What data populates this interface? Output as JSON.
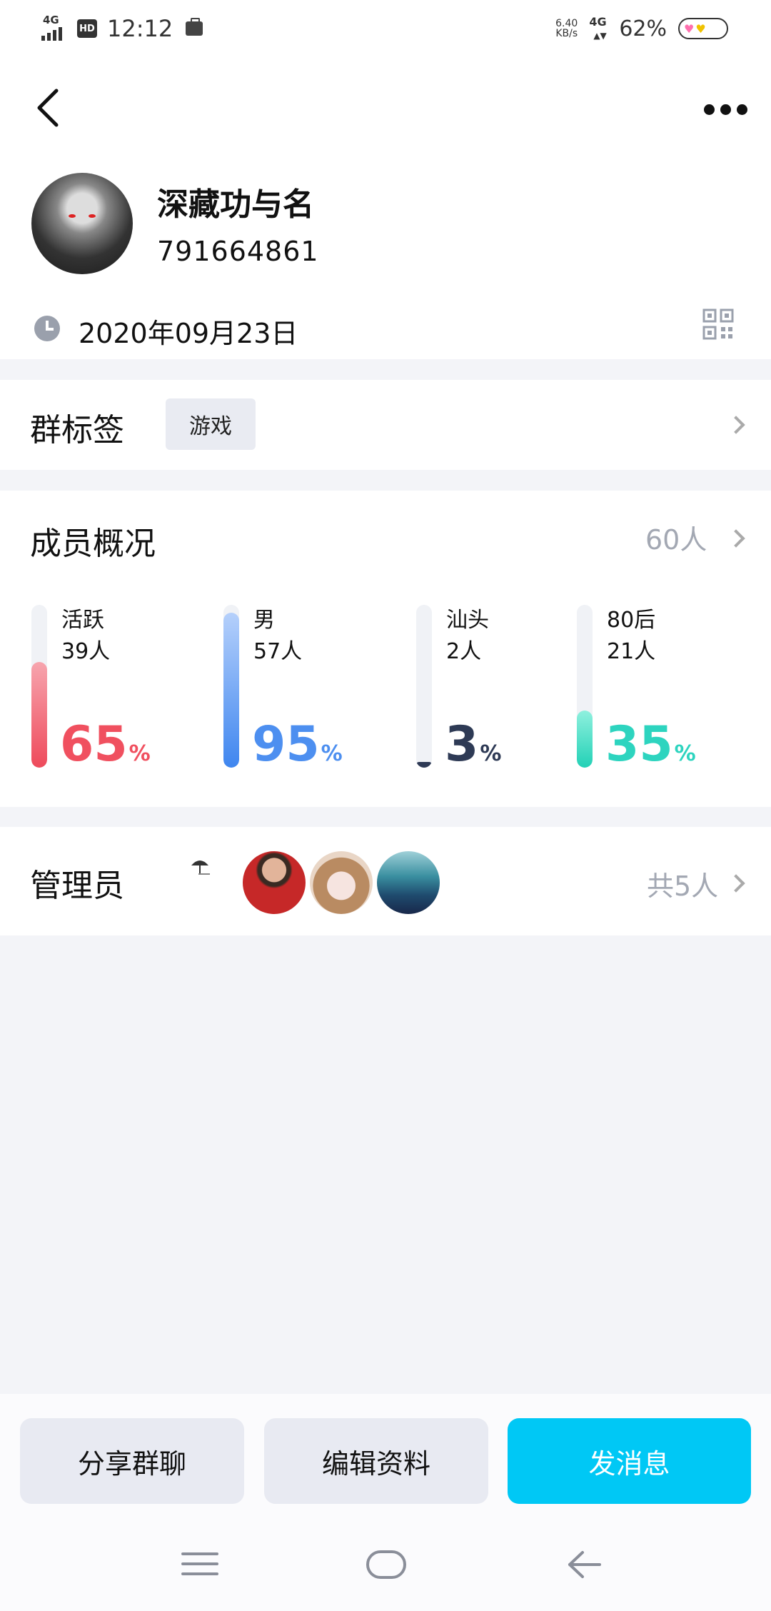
{
  "status_bar": {
    "network_label": "4G",
    "hd_badge": "HD",
    "time": "12:12",
    "speed_value": "6.40",
    "speed_unit": "KB/s",
    "network_right": "4G",
    "battery_percent": "62%"
  },
  "header": {
    "back_icon": "chevron-left-icon",
    "more_icon": "more-dots-icon"
  },
  "group": {
    "name": "深藏功与名",
    "id": "791664861",
    "created_date": "2020年09月23日"
  },
  "tags": {
    "title": "群标签",
    "items": [
      "游戏"
    ]
  },
  "members": {
    "title": "成员概况",
    "total": "60人",
    "stats": [
      {
        "label": "活跃",
        "count": "39人",
        "percent": "65",
        "percent_symbol": "%",
        "fraction": 0.65,
        "color": "#f0505f"
      },
      {
        "label": "男",
        "count": "57人",
        "percent": "95",
        "percent_symbol": "%",
        "fraction": 0.95,
        "color": "#4d8ff0"
      },
      {
        "label": "汕头",
        "count": "2人",
        "percent": "3",
        "percent_symbol": "%",
        "fraction": 0.03,
        "color": "#2e3a55"
      },
      {
        "label": "80后",
        "count": "21人",
        "percent": "35",
        "percent_symbol": "%",
        "fraction": 0.35,
        "color": "#2dd4bf"
      }
    ]
  },
  "admins": {
    "title": "管理员",
    "total": "共5人"
  },
  "actions": {
    "share": "分享群聊",
    "edit": "编辑资料",
    "message": "发消息"
  },
  "colors": {
    "primary": "#00c8f5",
    "background": "#f3f4f8"
  }
}
